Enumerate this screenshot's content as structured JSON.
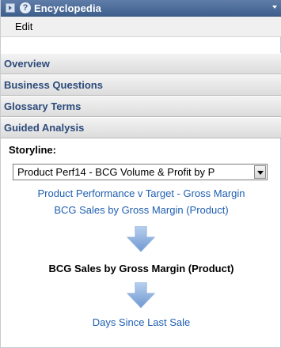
{
  "panel": {
    "title": "Encyclopedia",
    "help_glyph": "?"
  },
  "menu": {
    "edit_label": "Edit"
  },
  "sections": {
    "overview": "Overview",
    "business_questions": "Business Questions",
    "glossary_terms": "Glossary Terms",
    "guided_analysis": "Guided Analysis"
  },
  "storyline": {
    "label": "Storyline:",
    "selected_value": "Product Perf14 - BCG Volume & Profit by P"
  },
  "flow": {
    "link_previous_1": "Product Performance v Target - Gross Margin",
    "link_previous_2": "BCG Sales by Gross Margin (Product)",
    "current": "BCG Sales by Gross Margin (Product)",
    "link_next": "Days Since Last Sale"
  },
  "colors": {
    "title_bar": "#4a6a98",
    "section_text": "#2c4a7a",
    "link": "#1f5fb0",
    "arrow": "#7aa2d8"
  }
}
